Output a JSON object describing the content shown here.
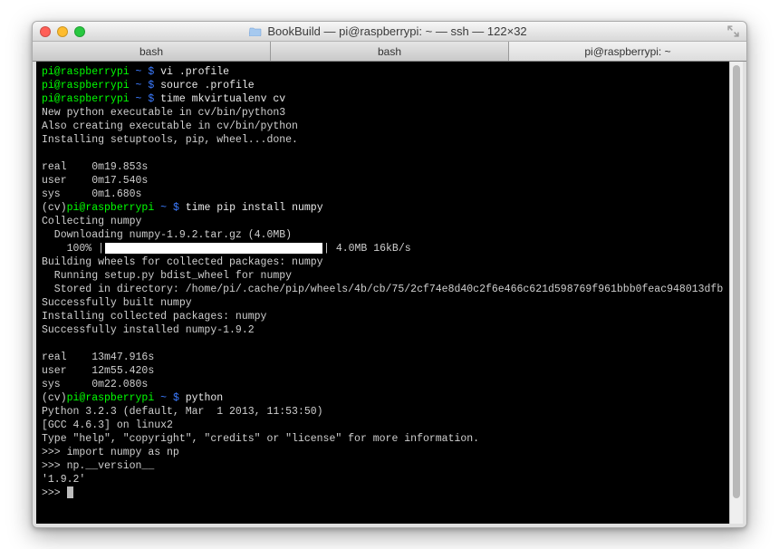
{
  "titlebar": {
    "title": "BookBuild — pi@raspberrypi: ~ — ssh — 122×32"
  },
  "tabs": [
    {
      "label": "bash"
    },
    {
      "label": "bash"
    },
    {
      "label": "pi@raspberrypi: ~"
    }
  ],
  "colors": {
    "term_bg": "#000000",
    "prompt_user": "#00ff00",
    "prompt_path": "#3b7bff",
    "text": "#cfcfcf"
  },
  "prompt": {
    "userhost": "pi@raspberrypi",
    "path": "~",
    "venv": "(cv)",
    "sep": "$"
  },
  "lines": {
    "cmd1": "vi .profile",
    "cmd2": "source .profile",
    "cmd3": "time mkvirtualenv cv",
    "exec1": "New python executable in cv/bin/python3",
    "exec2": "Also creating executable in cv/bin/python",
    "exec3": "Installing setuptools, pip, wheel...done.",
    "time1_real": "real    0m19.853s",
    "time1_user": "user    0m17.540s",
    "time1_sys": "sys     0m1.680s",
    "cmd4": "time pip install numpy",
    "pip1": "Collecting numpy",
    "pip2": "  Downloading numpy-1.9.2.tar.gz (4.0MB)",
    "pip_pct": "    100% |",
    "pip_rate": "| 4.0MB 16kB/s",
    "pip3": "Building wheels for collected packages: numpy",
    "pip4": "  Running setup.py bdist_wheel for numpy",
    "pip5": "  Stored in directory: /home/pi/.cache/pip/wheels/4b/cb/75/2cf74e8d40c2f6e466c621d598769f961bbb0feac948013dfb",
    "pip6": "Successfully built numpy",
    "pip7": "Installing collected packages: numpy",
    "pip8": "Successfully installed numpy-1.9.2",
    "time2_real": "real    13m47.916s",
    "time2_user": "user    12m55.420s",
    "time2_sys": "sys     0m22.080s",
    "cmd5": "python",
    "py1": "Python 3.2.3 (default, Mar  1 2013, 11:53:50)",
    "py2": "[GCC 4.6.3] on linux2",
    "py3": "Type \"help\", \"copyright\", \"credits\" or \"license\" for more information.",
    "pyprompt": ">>> ",
    "pycmd1": "import numpy as np",
    "pycmd2": "np.__version__",
    "pyout": "'1.9.2'"
  }
}
